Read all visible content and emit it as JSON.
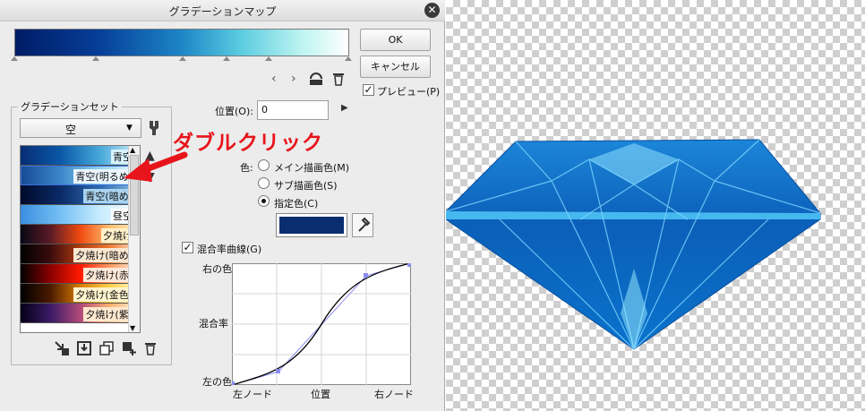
{
  "dialog": {
    "title": "グラデーションマップ",
    "ok": "OK",
    "cancel": "キャンセル",
    "preview": "プレビュー(P)",
    "position_label": "位置(O):",
    "position_value": "0",
    "color_label": "色:",
    "radio_main": "メイン描画色(M)",
    "radio_sub": "サブ描画色(S)",
    "radio_specified": "指定色(C)",
    "specified_color": "#0a2d70",
    "curve_check": "混合率曲線(G)",
    "curve_y_top": "右の色",
    "curve_y_mid": "混合率",
    "curve_y_bottom": "左の色",
    "curve_x_left": "左ノード",
    "curve_x_mid": "位置",
    "curve_x_right": "右ノード"
  },
  "gradient_set": {
    "title": "グラデーションセット",
    "selected": "空",
    "items": [
      {
        "label": "青空",
        "gradient": "linear-gradient(90deg,#072d74,#0a58a8,#46a8d8,#d6f2ff)"
      },
      {
        "label": "青空(明るめ)",
        "gradient": "linear-gradient(90deg,#174a96,#3a86c8,#8fd2ee,#f0fbff)"
      },
      {
        "label": "青空(暗め)",
        "gradient": "linear-gradient(90deg,#000a2a,#0a2a66,#2f6ab0,#8cc2e6)"
      },
      {
        "label": "昼空",
        "gradient": "linear-gradient(90deg,#3a8fe0,#74bff3,#c8ecff,#ffffff)"
      },
      {
        "label": "夕焼け",
        "gradient": "linear-gradient(90deg,#080816,#5a1a26,#f04a10,#ffc070,#fff0c8)"
      },
      {
        "label": "夕焼け(暗め)",
        "gradient": "linear-gradient(90deg,#000,#3a0c0c,#b03a10,#f07a30,#fff0d8)"
      },
      {
        "label": "夕焼け(赤)",
        "gradient": "linear-gradient(90deg,#000,#8a0000,#ff1a00,#ff9a60,#fff0e0)"
      },
      {
        "label": "夕焼け(金色)",
        "gradient": "linear-gradient(90deg,#000,#4a1a00,#d87a00,#ffd24a,#fff8d0)"
      },
      {
        "label": "夕焼け(紫)",
        "gradient": "linear-gradient(90deg,#050016,#3a1a66,#b04a7a,#ffb070,#fff0d8)"
      }
    ]
  },
  "annotation": "ダブルクリック"
}
